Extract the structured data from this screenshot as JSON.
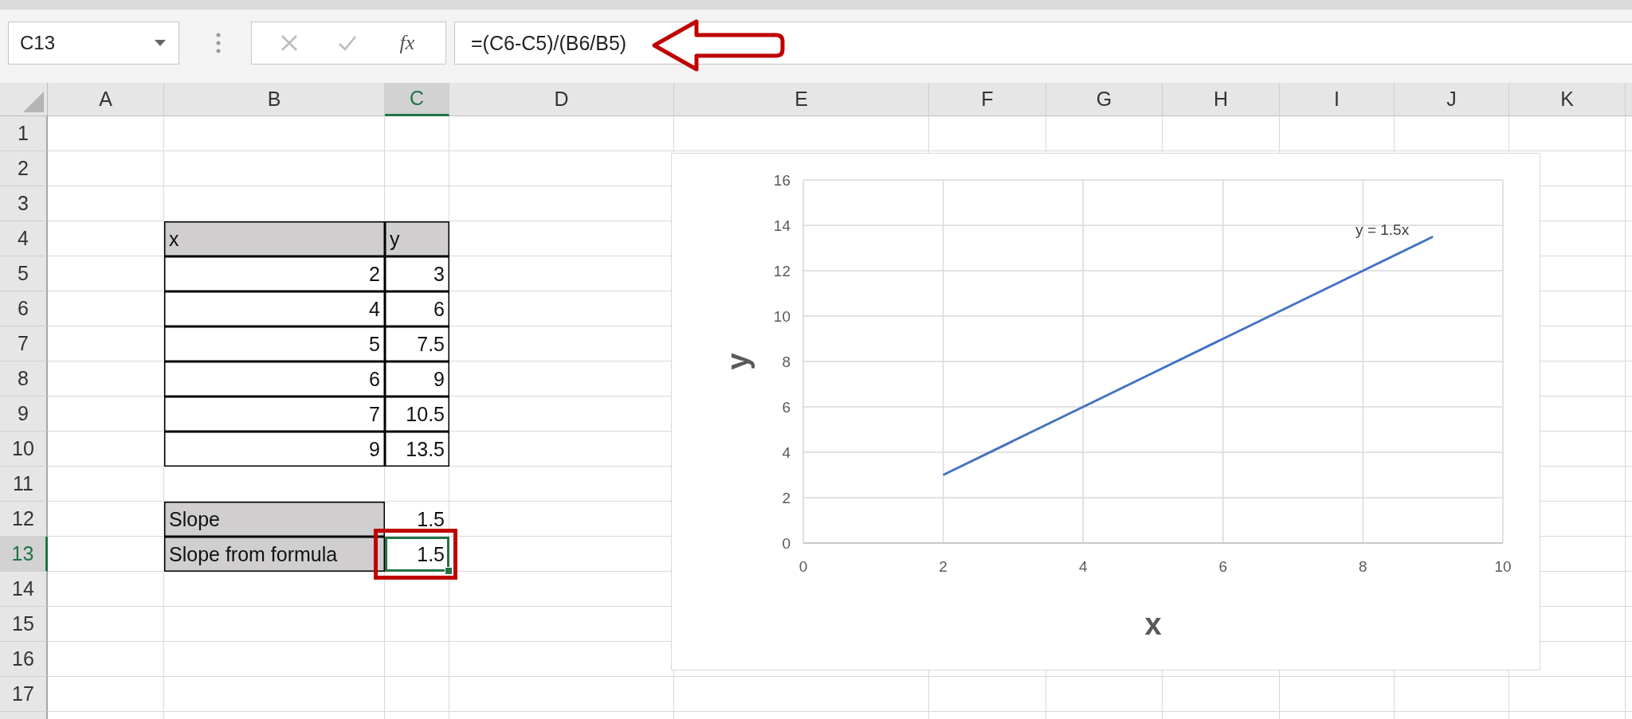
{
  "formula_bar": {
    "name_box": "C13",
    "function_button": "fx",
    "formula": "=(C6-C5)/(B6/B5)"
  },
  "columns": [
    {
      "label": "A",
      "selected": false
    },
    {
      "label": "B",
      "selected": false
    },
    {
      "label": "C",
      "selected": true
    },
    {
      "label": "D",
      "selected": false
    },
    {
      "label": "E",
      "selected": false
    },
    {
      "label": "F",
      "selected": false
    },
    {
      "label": "G",
      "selected": false
    },
    {
      "label": "H",
      "selected": false
    },
    {
      "label": "I",
      "selected": false
    },
    {
      "label": "J",
      "selected": false
    },
    {
      "label": "K",
      "selected": false
    }
  ],
  "rows": [
    {
      "label": "1",
      "selected": false
    },
    {
      "label": "2",
      "selected": false
    },
    {
      "label": "3",
      "selected": false
    },
    {
      "label": "4",
      "selected": false
    },
    {
      "label": "5",
      "selected": false
    },
    {
      "label": "6",
      "selected": false
    },
    {
      "label": "7",
      "selected": false
    },
    {
      "label": "8",
      "selected": false
    },
    {
      "label": "9",
      "selected": false
    },
    {
      "label": "10",
      "selected": false
    },
    {
      "label": "11",
      "selected": false
    },
    {
      "label": "12",
      "selected": false
    },
    {
      "label": "13",
      "selected": true
    },
    {
      "label": "14",
      "selected": false
    },
    {
      "label": "15",
      "selected": false
    },
    {
      "label": "16",
      "selected": false
    },
    {
      "label": "17",
      "selected": false
    }
  ],
  "data_table": {
    "header": [
      "x",
      "y"
    ],
    "rows": [
      [
        "2",
        "3"
      ],
      [
        "4",
        "6"
      ],
      [
        "5",
        "7.5"
      ],
      [
        "6",
        "9"
      ],
      [
        "7",
        "10.5"
      ],
      [
        "9",
        "13.5"
      ]
    ]
  },
  "slope_table": [
    {
      "label": "Slope",
      "value": "1.5",
      "selected": false
    },
    {
      "label": "Slope from formula",
      "value": "1.5",
      "selected": true
    }
  ],
  "chart": {
    "chart_data": {
      "type": "line",
      "xlabel": "x",
      "ylabel": "y",
      "x": [
        2,
        4,
        5,
        6,
        7,
        9
      ],
      "series": [
        {
          "color": "#4472c4",
          "values": [
            3,
            6,
            7.5,
            9,
            10.5,
            13.5
          ]
        }
      ],
      "grid": true,
      "xlim": [
        0,
        10
      ],
      "ylim": [
        0,
        16
      ],
      "xticks": [
        0,
        2,
        4,
        6,
        8,
        10
      ],
      "yticks": [
        0,
        2,
        4,
        6,
        8,
        10,
        12,
        14,
        16
      ],
      "annotations": [
        "y = 1.5x"
      ]
    }
  }
}
